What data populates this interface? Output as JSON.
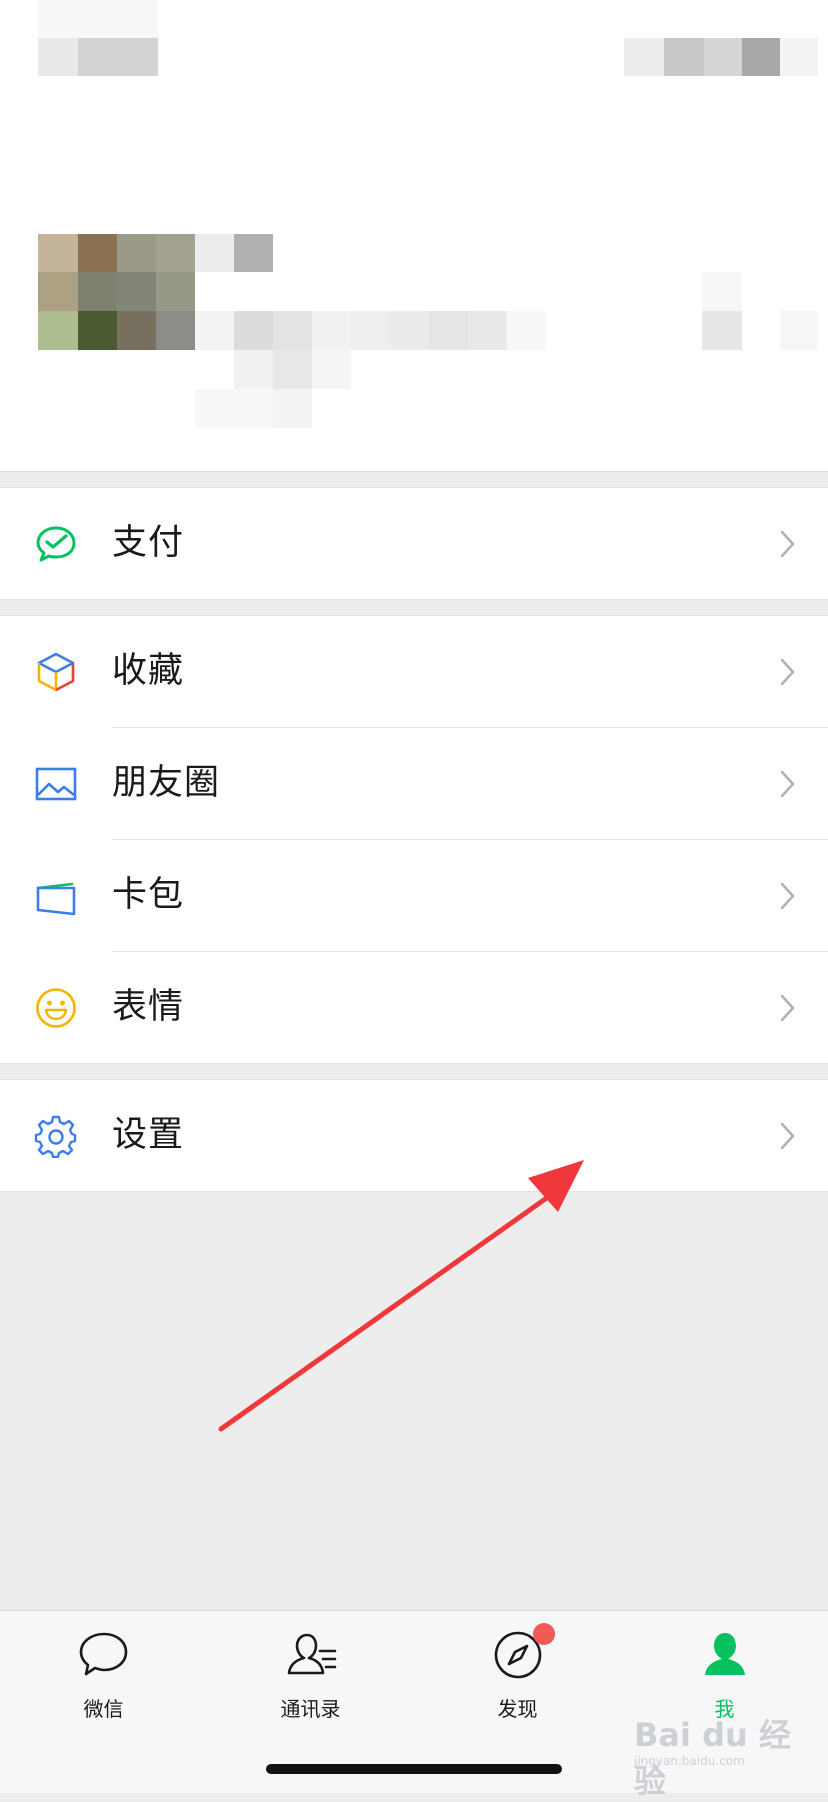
{
  "profile": {
    "blurred": true
  },
  "menu": {
    "pay": {
      "label": "支付",
      "icon": "wechat-pay-icon"
    },
    "favorites": {
      "label": "收藏",
      "icon": "cube-icon"
    },
    "moments": {
      "label": "朋友圈",
      "icon": "image-icon"
    },
    "cards": {
      "label": "卡包",
      "icon": "card-wallet-icon"
    },
    "stickers": {
      "label": "表情",
      "icon": "smiley-icon"
    },
    "settings": {
      "label": "设置",
      "icon": "gear-icon"
    }
  },
  "tabbar": {
    "tabs": [
      {
        "label": "微信",
        "icon": "chat-bubble-icon",
        "active": false
      },
      {
        "label": "通讯录",
        "icon": "contacts-icon",
        "active": false
      },
      {
        "label": "发现",
        "icon": "compass-icon",
        "active": false,
        "badge": true
      },
      {
        "label": "我",
        "icon": "person-icon",
        "active": true
      }
    ]
  },
  "colors": {
    "accent_green": "#07c160",
    "annotation_arrow": "#f0373b",
    "badge_red": "#f25a55"
  },
  "watermark": {
    "brand": "Bai du 经验",
    "url": "jingyan.baidu.com"
  }
}
